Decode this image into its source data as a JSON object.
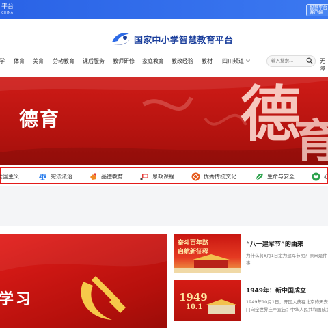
{
  "topbar": {
    "site_name": "平台",
    "site_name_en": "CHINA",
    "login_label": "智慧平台客户端"
  },
  "brand": {
    "title": "国家中小学智慧教育平台"
  },
  "nav": {
    "items": [
      "学",
      "体育",
      "美育",
      "劳动教育",
      "课后服务",
      "教师研修",
      "家庭教育",
      "教改经验",
      "教材",
      "四川频道"
    ],
    "search_placeholder": "输入搜索...",
    "extra": "无障"
  },
  "banner": {
    "heading": "德育",
    "big_char": "德",
    "big_char2": "育"
  },
  "categories": [
    {
      "label": "爱国主义",
      "icon": "flag-icon",
      "color": "#e53935"
    },
    {
      "label": "宪法法治",
      "icon": "scales-icon",
      "color": "#2f80ed"
    },
    {
      "label": "品德教育",
      "icon": "hand-icon",
      "color": "#f08a24"
    },
    {
      "label": "思政课程",
      "icon": "board-icon",
      "color": "#e53935"
    },
    {
      "label": "优秀传统文化",
      "icon": "knot-icon",
      "color": "#e55a1c"
    },
    {
      "label": "生命与安全",
      "icon": "leaf-icon",
      "color": "#2ca24c"
    },
    {
      "label": "心",
      "icon": "heart-leaf-icon",
      "color": "#2ca24c"
    }
  ],
  "feature": {
    "word": "学习"
  },
  "news": [
    {
      "title": "“八一建军节”的由来",
      "desc": "为什么将8月1日定为建军节呢？原来是件事……",
      "thumb_text1": "奋斗百年路",
      "thumb_text2": "启航新征程"
    },
    {
      "title": "1949年：新中国成立",
      "desc": "1949年10月1日，开国大典在北京的天安门向全世界庄严宣告：中华人民共和国成立",
      "thumb_text1": "1949",
      "thumb_text2": "10.1"
    }
  ],
  "colors": {
    "topbar": "#2a63e6",
    "banner_red": "#c1160f",
    "strip_border": "#e31b1b",
    "brand_blue": "#1b3f9c"
  }
}
